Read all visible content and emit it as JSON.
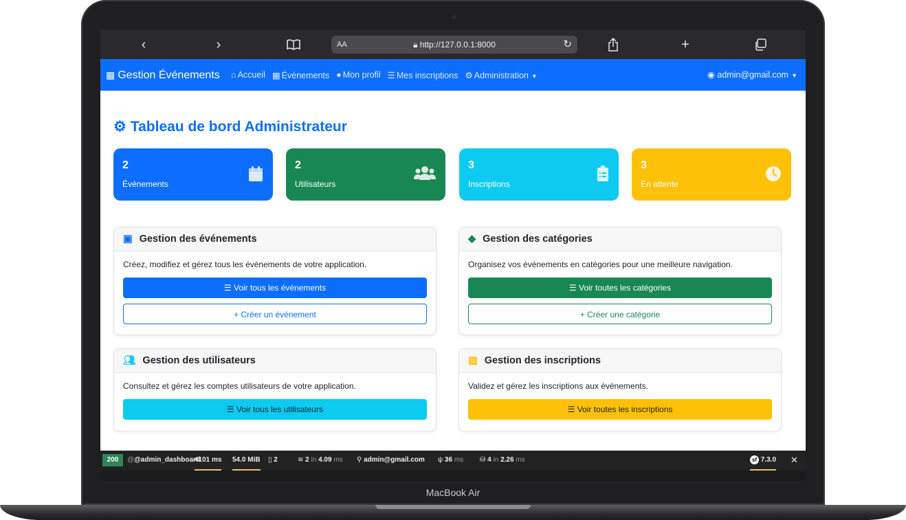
{
  "device_label": "MacBook Air",
  "browser": {
    "text_size_label": "AA",
    "url": "http://127.0.0.1:8000",
    "icons": [
      "back-icon",
      "forward-icon",
      "bookmarks-icon",
      "lock-icon",
      "reload-icon",
      "share-icon",
      "new-tab-icon",
      "tabs-icon"
    ]
  },
  "navbar": {
    "brand": "Gestion Événements",
    "links": [
      {
        "icon": "home-icon",
        "label": "Accueil"
      },
      {
        "icon": "calendar-icon",
        "label": "Événements"
      },
      {
        "icon": "user-icon",
        "label": "Mon profil"
      },
      {
        "icon": "list-icon",
        "label": "Mes inscriptions"
      },
      {
        "icon": "cogs-icon",
        "label": "Administration"
      }
    ],
    "user": "admin@gmail.com"
  },
  "page": {
    "title": "Tableau de bord Administrateur",
    "stats": [
      {
        "value": "2",
        "label": "Événements",
        "color": "#0d6efd",
        "icon": "calendar-icon"
      },
      {
        "value": "2",
        "label": "Utilisateurs",
        "color": "#198754",
        "icon": "users-icon"
      },
      {
        "value": "3",
        "label": "Inscriptions",
        "color": "#0dcaf0",
        "icon": "clipboard-list-icon"
      },
      {
        "value": "3",
        "label": "En attente",
        "color": "#ffc107",
        "icon": "clock-icon"
      }
    ],
    "cards": [
      {
        "title": "Gestion des événements",
        "icon": "calendar-plus-icon",
        "text": "Créez, modifiez et gérez tous les événements de votre application.",
        "primary": "Voir tous les événements",
        "secondary": "Créer un événement",
        "color": "#0d6efd"
      },
      {
        "title": "Gestion des catégories",
        "icon": "tags-icon",
        "text": "Organisez vos événements en catégories pour une meilleure navigation.",
        "primary": "Voir toutes les catégories",
        "secondary": "Créer une catégorie",
        "color": "#198754"
      },
      {
        "title": "Gestion des utilisateurs",
        "icon": "users-icon",
        "text": "Consultez et gérez les comptes utilisateurs de votre application.",
        "primary": "Voir tous les utilisateurs",
        "color": "#0dcaf0"
      },
      {
        "title": "Gestion des inscriptions",
        "icon": "clipboard-check-icon",
        "text": "Validez et gérez les inscriptions aux événements.",
        "primary": "Voir toutes les inscriptions",
        "color": "#ffc107"
      }
    ]
  },
  "debug_toolbar": {
    "status": "200",
    "route": "@admin_dashboard",
    "time": "4101 ms",
    "memory": "54.0 MiB",
    "files": "2",
    "cache_count": "2",
    "cache_in": "in",
    "cache_time": "4.09",
    "cache_unit": "ms",
    "user": "admin@gmail.com",
    "twig_time": "36",
    "twig_unit": "ms",
    "db_count": "4",
    "db_in": "in",
    "db_time": "2.26",
    "db_unit": "ms",
    "version": "7.3.0"
  }
}
